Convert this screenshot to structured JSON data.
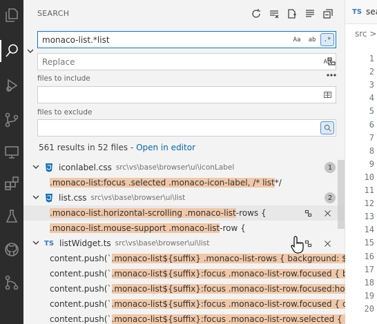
{
  "activity": [
    "explorer-icon",
    "search-icon",
    "run-debug-icon",
    "source-control-icon",
    "remote-explorer-icon",
    "extensions-icon",
    "testing-icon",
    "github-icon",
    "branches-icon"
  ],
  "search": {
    "title": "SEARCH",
    "query": "monaco-list.*list",
    "match_case": "Aa",
    "whole_word": "ab",
    "regex": ".*",
    "replace_placeholder": "Replace",
    "preserve_case": "AB",
    "include_label": "files to include",
    "exclude_label": "files to exclude",
    "summary": "561 results in 52 files - ",
    "open_in_editor": "Open in editor"
  },
  "results": [
    {
      "name": "iconlabel.css",
      "path": "src\\vs\\base\\browser\\ui\\iconLabel",
      "count": "1",
      "matches": [
        {
          "pre": "",
          "hl": ".monaco-list:focus .selected .monaco-icon-label, /* list",
          "post": " */"
        }
      ]
    },
    {
      "name": "list.css",
      "path": "src\\vs\\base\\browser\\ui\\list",
      "count": "2",
      "matches": [
        {
          "pre": "",
          "hl": ".monaco-list.horizontal-scrolling .monaco-list",
          "post": "-rows {"
        },
        {
          "pre": "",
          "hl": ".monaco-list.mouse-support .monaco-list",
          "post": "-row {"
        }
      ]
    },
    {
      "name": "listWidget.ts",
      "path": "src\\vs\\base\\browser\\ui\\list",
      "matches": [
        {
          "pre": "content.push(`",
          "hl": ".monaco-list${suffix} .monaco-list-rows { background: ${st",
          "post": ""
        },
        {
          "pre": "content.push(`",
          "hl": ".monaco-list${suffix}:focus .monaco-list-row.focused { bac",
          "post": ""
        },
        {
          "pre": "content.push(`",
          "hl": ".monaco-list${suffix}:focus .monaco-list-row.focused:hover",
          "post": ""
        },
        {
          "pre": "content.push(`",
          "hl": ".monaco-list${suffix}:focus .monaco-list-row.focused { colo",
          "post": ""
        },
        {
          "pre": "content.push(`",
          "hl": ".monaco-list${suffix}:focus .monaco-list-row.selected { bac",
          "post": ""
        }
      ]
    }
  ],
  "editor": {
    "tab_icon": "TS",
    "tab_name": "sear",
    "crumb": "src >",
    "lines": [
      "1",
      "2",
      "3",
      "4",
      "5",
      "6",
      "7",
      "8",
      "9",
      "10",
      "11",
      "12",
      "13",
      "14",
      "15",
      "16",
      "17",
      "18",
      "19",
      "20"
    ]
  }
}
